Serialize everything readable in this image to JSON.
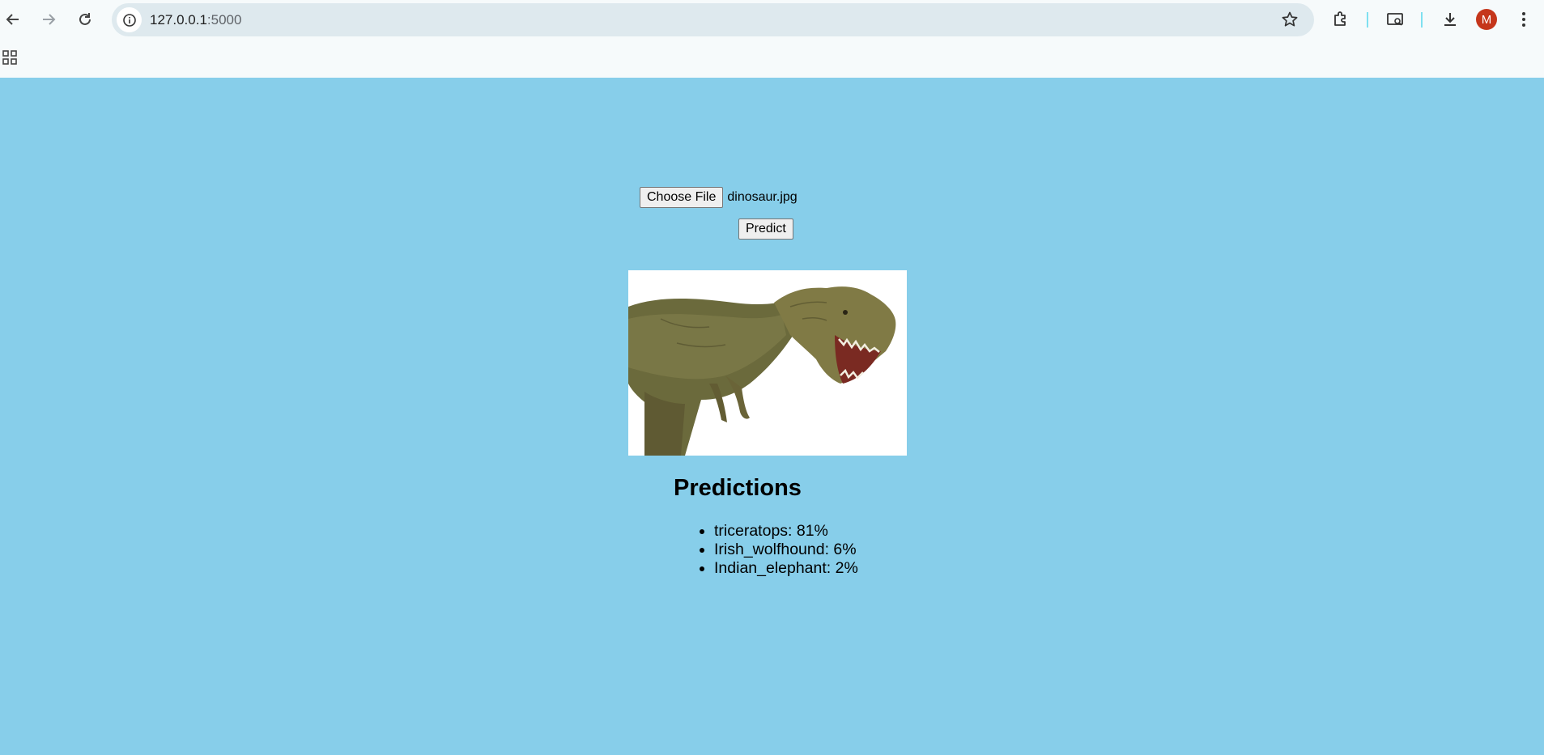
{
  "browser": {
    "url_host": "127.0.0.1",
    "url_port": ":5000",
    "profile_initial": "M",
    "colors": {
      "toolbar_bg": "#f6fafb",
      "omnibox_bg": "#dee9ee",
      "avatar_bg": "#c5361b"
    },
    "icons": [
      "back-icon",
      "forward-icon",
      "reload-icon",
      "site-info-icon",
      "bookmark-star-icon",
      "extensions-icon",
      "media-search-icon",
      "download-icon",
      "more-menu-icon",
      "apps-grid-icon"
    ]
  },
  "page": {
    "background": "#87ceea",
    "upload": {
      "choose_label": "Choose File",
      "file_name": "dinosaur.jpg",
      "predict_label": "Predict"
    },
    "preview_image": "dinosaur-image",
    "predictions": {
      "title": "Predictions",
      "items": [
        "triceratops: 81%",
        "Irish_wolfhound: 6%",
        "Indian_elephant: 2%"
      ]
    }
  }
}
